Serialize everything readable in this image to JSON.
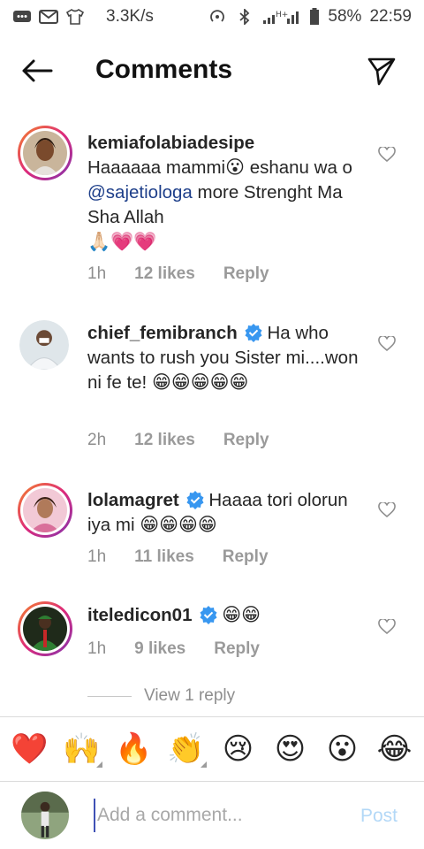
{
  "status_bar": {
    "speed": "3.3K/s",
    "battery": "58%",
    "time": "22:59",
    "network": "H+"
  },
  "header": {
    "title": "Comments"
  },
  "comments": [
    {
      "username": "kemiafolabiadesipe",
      "verified": false,
      "text_parts": [
        "Haaaaaa mammi",
        "😮",
        " eshanu wa o ",
        "@sajetiologa",
        " more Strenght Ma Sha Allah ",
        "🙏🏻💗💗"
      ],
      "time": "1h",
      "likes": "12 likes",
      "reply": "Reply"
    },
    {
      "username": "chief_femibranch",
      "verified": true,
      "text": "Ha who wants to rush you Sister mi....won ni fe te! ",
      "emojis": "😁😁😁😁😁",
      "time": "2h",
      "likes": "12 likes",
      "reply": "Reply"
    },
    {
      "username": "lolamagret",
      "verified": true,
      "text": "Haaaa tori olorun iya mi ",
      "emojis": "😁😁😁😁",
      "time": "1h",
      "likes": "11 likes",
      "reply": "Reply"
    },
    {
      "username": "iteledicon01",
      "verified": true,
      "text": "",
      "emojis": "😁😁",
      "time": "1h",
      "likes": "9 likes",
      "reply": "Reply"
    }
  ],
  "view_replies": "View 1 reply",
  "emoji_bar": [
    "❤️",
    "🙌",
    "🔥",
    "👏",
    "😢",
    "😍",
    "😮",
    "😂"
  ],
  "input": {
    "placeholder": "Add a comment...",
    "post_label": "Post"
  },
  "colors": {
    "accent_link": "#1e3f8a",
    "verified_blue": "#3897f0",
    "post_disabled": "#b3d8f7"
  }
}
